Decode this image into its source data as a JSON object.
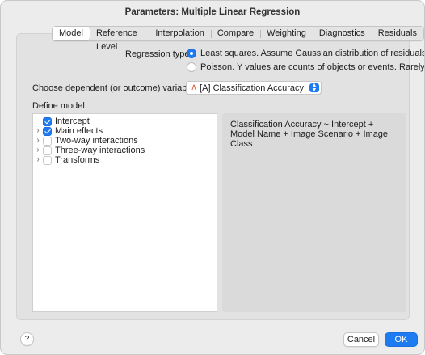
{
  "window": {
    "title": "Parameters: Multiple Linear Regression"
  },
  "tabs": [
    {
      "label": "Model",
      "active": true
    },
    {
      "label": "Reference Level",
      "active": false
    },
    {
      "label": "Interpolation",
      "active": false
    },
    {
      "label": "Compare",
      "active": false
    },
    {
      "label": "Weighting",
      "active": false
    },
    {
      "label": "Diagnostics",
      "active": false
    },
    {
      "label": "Residuals",
      "active": false
    }
  ],
  "regression": {
    "label": "Regression type:",
    "options": [
      {
        "label": "Least squares. Assume Gaussian distribution of residuals.",
        "selected": true
      },
      {
        "label": "Poisson. Y values are counts of objects or events. Rarely used.",
        "selected": false
      }
    ]
  },
  "dependent": {
    "label": "Choose dependent (or outcome) variable (Y):",
    "selected": "[A] Classification Accuracy",
    "icon": "triangle-icon",
    "icon_color": "#e0663d"
  },
  "model": {
    "label": "Define model:",
    "items": [
      {
        "label": "Intercept",
        "checked": true,
        "expandable": false
      },
      {
        "label": "Main effects",
        "checked": true,
        "expandable": true
      },
      {
        "label": "Two-way interactions",
        "checked": false,
        "expandable": true
      },
      {
        "label": "Three-way interactions",
        "checked": false,
        "expandable": true
      },
      {
        "label": "Transforms",
        "checked": false,
        "expandable": true
      }
    ],
    "formula": "Classification Accuracy ~ Intercept + Model Name + Image Scenario + Image Class"
  },
  "footer": {
    "help_label": "?",
    "cancel_label": "Cancel",
    "ok_label": "OK"
  },
  "colors": {
    "accent": "#1f7bf2"
  }
}
